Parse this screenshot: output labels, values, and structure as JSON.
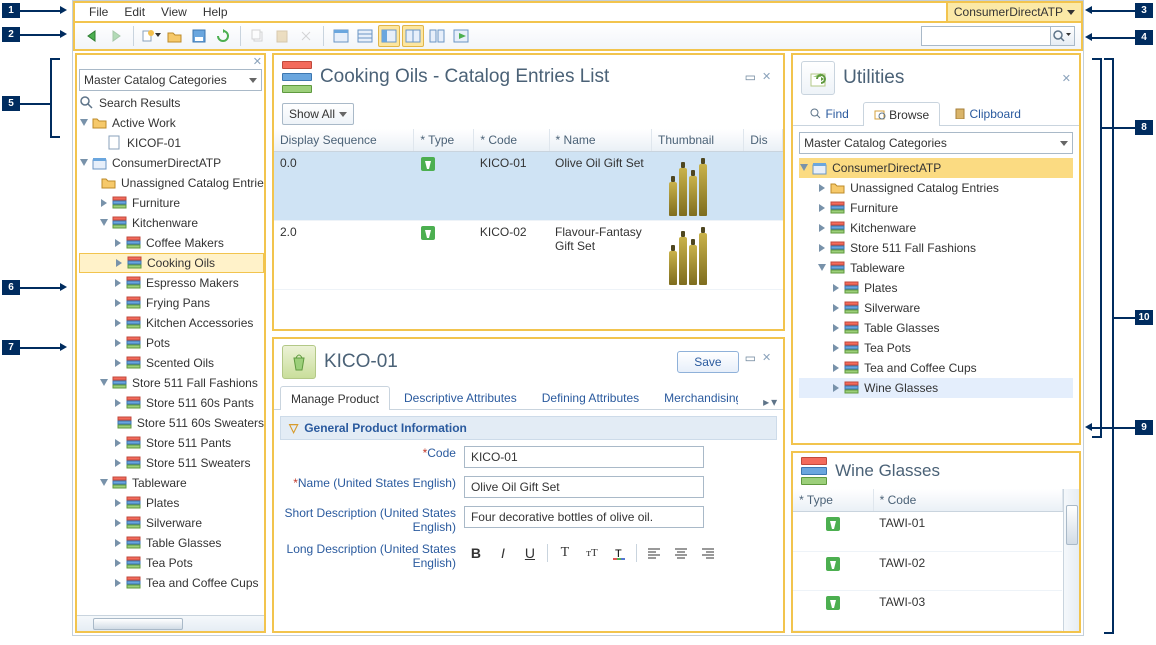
{
  "menubar": {
    "items": [
      "File",
      "Edit",
      "View",
      "Help"
    ]
  },
  "store_selector": "ConsumerDirectATP",
  "toolbar": {
    "search_placeholder": ""
  },
  "explorer": {
    "combo": "Master Catalog Categories",
    "search_results": "Search Results",
    "active_work": "Active Work",
    "active_work_items": [
      "KICOF-01"
    ],
    "store_root": "ConsumerDirectATP",
    "rows": [
      {
        "label": "Unassigned Catalog Entries",
        "depth": 1,
        "icon": "folder"
      },
      {
        "label": "Furniture",
        "depth": 1,
        "icon": "bars"
      },
      {
        "label": "Kitchenware",
        "depth": 1,
        "icon": "bars",
        "expanded": true
      },
      {
        "label": "Coffee Makers",
        "depth": 2,
        "icon": "bars"
      },
      {
        "label": "Cooking Oils",
        "depth": 2,
        "icon": "bars",
        "sel": true
      },
      {
        "label": "Espresso Makers",
        "depth": 2,
        "icon": "bars"
      },
      {
        "label": "Frying Pans",
        "depth": 2,
        "icon": "bars"
      },
      {
        "label": "Kitchen Accessories",
        "depth": 2,
        "icon": "bars"
      },
      {
        "label": "Pots",
        "depth": 2,
        "icon": "bars"
      },
      {
        "label": "Scented Oils",
        "depth": 2,
        "icon": "bars"
      },
      {
        "label": "Store 511 Fall Fashions",
        "depth": 1,
        "icon": "bars",
        "expanded": true
      },
      {
        "label": "Store 511 60s Pants",
        "depth": 2,
        "icon": "bars"
      },
      {
        "label": "Store 511 60s Sweaters",
        "depth": 2,
        "icon": "bars"
      },
      {
        "label": "Store 511 Pants",
        "depth": 2,
        "icon": "bars"
      },
      {
        "label": "Store 511 Sweaters",
        "depth": 2,
        "icon": "bars"
      },
      {
        "label": "Tableware",
        "depth": 1,
        "icon": "bars",
        "expanded": true
      },
      {
        "label": "Plates",
        "depth": 2,
        "icon": "bars"
      },
      {
        "label": "Silverware",
        "depth": 2,
        "icon": "bars"
      },
      {
        "label": "Table Glasses",
        "depth": 2,
        "icon": "bars"
      },
      {
        "label": "Tea Pots",
        "depth": 2,
        "icon": "bars"
      },
      {
        "label": "Tea and Coffee Cups",
        "depth": 2,
        "icon": "bars"
      }
    ]
  },
  "list_panel": {
    "title": "Cooking Oils - Catalog Entries List",
    "show_all": "Show All",
    "columns": [
      "Display Sequence",
      "* Type",
      "* Code",
      "* Name",
      "Thumbnail",
      "Dis"
    ],
    "rows": [
      {
        "seq": "0.0",
        "code": "KICO-01",
        "name": "Olive Oil Gift Set",
        "sel": true
      },
      {
        "seq": "2.0",
        "code": "KICO-02",
        "name": "Flavour-Fantasy Gift Set"
      }
    ]
  },
  "detail_panel": {
    "title": "KICO-01",
    "save": "Save",
    "tabs": [
      "Manage Product",
      "Descriptive Attributes",
      "Defining Attributes",
      "Merchandising"
    ],
    "section": "General Product Information",
    "fields": {
      "code_label": "Code",
      "code_value": "KICO-01",
      "name_label": "Name (United States English)",
      "name_value": "Olive Oil Gift Set",
      "short_label": "Short Description (United States English)",
      "short_value": "Four decorative bottles of olive oil.",
      "long_label": "Long Description (United States English)"
    }
  },
  "utilities": {
    "title": "Utilities",
    "tabs": [
      "Find",
      "Browse",
      "Clipboard"
    ],
    "combo": "Master Catalog Categories",
    "root": "ConsumerDirectATP",
    "rows": [
      {
        "label": "Unassigned Catalog Entries",
        "depth": 1,
        "icon": "folder"
      },
      {
        "label": "Furniture",
        "depth": 1,
        "icon": "bars"
      },
      {
        "label": "Kitchenware",
        "depth": 1,
        "icon": "bars"
      },
      {
        "label": "Store 511 Fall Fashions",
        "depth": 1,
        "icon": "bars"
      },
      {
        "label": "Tableware",
        "depth": 1,
        "icon": "bars",
        "expanded": true
      },
      {
        "label": "Plates",
        "depth": 2,
        "icon": "bars"
      },
      {
        "label": "Silverware",
        "depth": 2,
        "icon": "bars"
      },
      {
        "label": "Table Glasses",
        "depth": 2,
        "icon": "bars"
      },
      {
        "label": "Tea Pots",
        "depth": 2,
        "icon": "bars"
      },
      {
        "label": "Tea and Coffee Cups",
        "depth": 2,
        "icon": "bars"
      },
      {
        "label": "Wine Glasses",
        "depth": 2,
        "icon": "bars",
        "sel": true
      }
    ]
  },
  "wine_panel": {
    "title": "Wine Glasses",
    "columns": [
      "* Type",
      "* Code"
    ],
    "rows": [
      "TAWI-01",
      "TAWI-02",
      "TAWI-03"
    ]
  },
  "callouts": [
    "1",
    "2",
    "3",
    "4",
    "5",
    "6",
    "7",
    "8",
    "9",
    "10"
  ]
}
